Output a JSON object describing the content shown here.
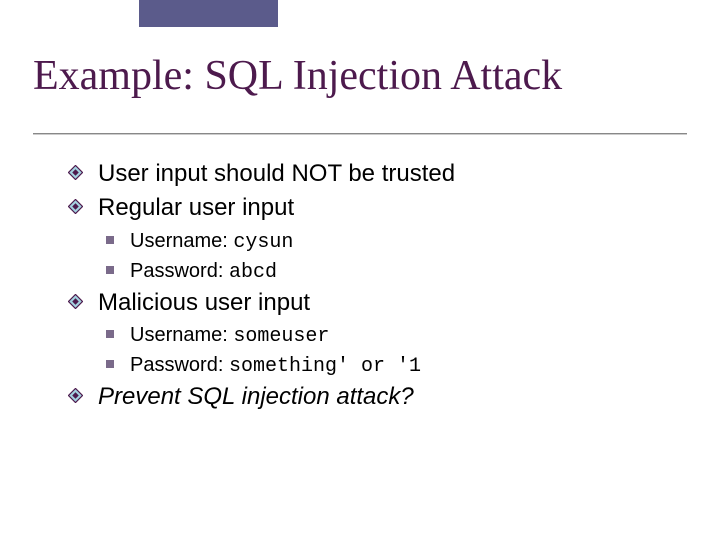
{
  "title": "Example: SQL Injection Attack",
  "bullets": {
    "b1": "User input should NOT be trusted",
    "b2": "Regular user input",
    "b2a_label": "Username: ",
    "b2a_value": "cysun",
    "b2b_label": "Password: ",
    "b2b_value": "abcd",
    "b3": "Malicious user input",
    "b3a_label": "Username: ",
    "b3a_value": "someuser",
    "b3b_label": "Password: ",
    "b3b_value": "something' or '1",
    "b4": "Prevent SQL injection attack?"
  }
}
